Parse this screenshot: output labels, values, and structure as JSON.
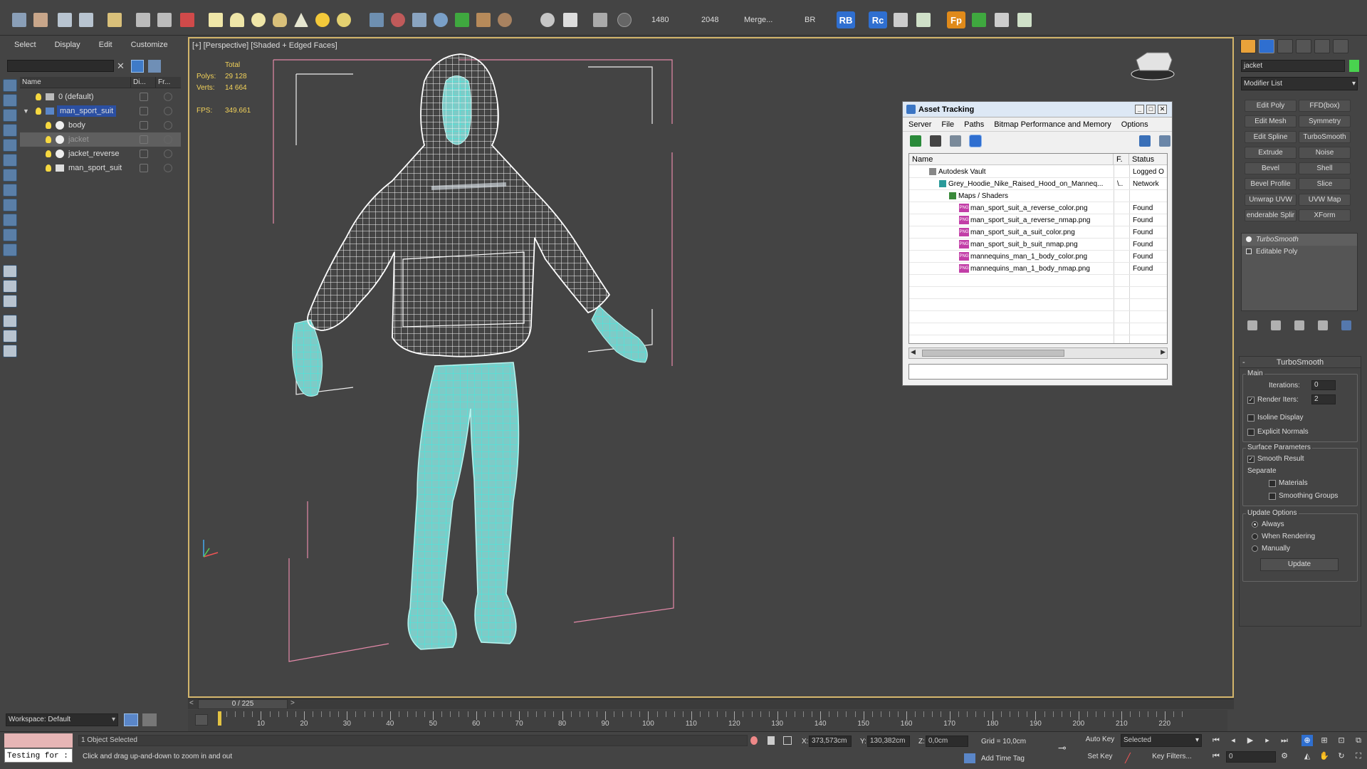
{
  "toolbar": {
    "values": [
      "1480",
      "2048"
    ],
    "merge_label": "Merge...",
    "br_label": "BR",
    "badges": [
      "RB",
      "Rc",
      "Fp"
    ]
  },
  "scene_explorer": {
    "menu": [
      "Select",
      "Display",
      "Edit",
      "Customize"
    ],
    "columns": {
      "name": "Name",
      "display": "Di...",
      "freeze": "Fr..."
    },
    "rows": [
      {
        "label": "0 (default)"
      },
      {
        "label": "man_sport_suit"
      },
      {
        "label": "body"
      },
      {
        "label": "jacket"
      },
      {
        "label": "jacket_reverse"
      },
      {
        "label": "man_sport_suit"
      }
    ],
    "workspace": "Workspace: Default"
  },
  "viewport": {
    "label": "[+] [Perspective] [Shaded + Edged Faces]",
    "stats": {
      "total_label": "Total",
      "polys_label": "Polys:",
      "polys_value": "29 128",
      "verts_label": "Verts:",
      "verts_value": "14 664",
      "fps_label": "FPS:",
      "fps_value": "349.661"
    }
  },
  "asset_tracking": {
    "title": "Asset Tracking",
    "menu": [
      "Server",
      "File",
      "Paths",
      "Bitmap Performance and Memory",
      "Options"
    ],
    "columns": {
      "name": "Name",
      "full_path": "F.",
      "status": "Status"
    },
    "rows": [
      {
        "name": "Autodesk Vault",
        "path": "",
        "status": "Logged O"
      },
      {
        "name": "Grey_Hoodie_Nike_Raised_Hood_on_Manneq...",
        "path": "\\..",
        "status": "Network"
      },
      {
        "name": "Maps / Shaders",
        "path": "",
        "status": ""
      },
      {
        "name": "man_sport_suit_a_reverse_color.png",
        "path": "",
        "status": "Found"
      },
      {
        "name": "man_sport_suit_a_reverse_nmap.png",
        "path": "",
        "status": "Found"
      },
      {
        "name": "man_sport_suit_a_suit_color.png",
        "path": "",
        "status": "Found"
      },
      {
        "name": "man_sport_suit_b_suit_nmap.png",
        "path": "",
        "status": "Found"
      },
      {
        "name": "mannequins_man_1_body_color.png",
        "path": "",
        "status": "Found"
      },
      {
        "name": "mannequins_man_1_body_nmap.png",
        "path": "",
        "status": "Found"
      }
    ],
    "file_badge": "PNG"
  },
  "command_panel": {
    "object_name": "jacket",
    "object_color": "#49d34f",
    "modifier_list": "Modifier List",
    "modifier_buttons": [
      "Edit Poly",
      "FFD(box)",
      "Edit Mesh",
      "Symmetry",
      "Edit Spline",
      "TurboSmooth",
      "Extrude",
      "Noise",
      "Bevel",
      "Shell",
      "Bevel Profile",
      "Slice",
      "Unwrap UVW",
      "UVW Map",
      "enderable Splir",
      "XForm"
    ],
    "stack": [
      "TurboSmooth",
      "Editable Poly"
    ],
    "turbosmooth": {
      "title": "TurboSmooth",
      "main_label": "Main",
      "iterations_label": "Iterations:",
      "iterations_value": "0",
      "render_iters_label": "Render Iters:",
      "render_iters_value": "2",
      "render_iters_checked": true,
      "isoline_label": "Isoline Display",
      "isoline_checked": false,
      "explicit_normals_label": "Explicit Normals",
      "explicit_normals_checked": false,
      "surface_label": "Surface Parameters",
      "smooth_result_label": "Smooth Result",
      "smooth_result_checked": true,
      "separate_label": "Separate",
      "materials_label": "Materials",
      "smoothing_groups_label": "Smoothing Groups",
      "update_options_label": "Update Options",
      "always_label": "Always",
      "when_rendering_label": "When Rendering",
      "manually_label": "Manually",
      "update_mode": "Always",
      "update_button": "Update"
    }
  },
  "timeline": {
    "frame_display": "0 / 225",
    "ticks": [
      0,
      10,
      20,
      30,
      40,
      50,
      60,
      70,
      80,
      90,
      100,
      110,
      120,
      130,
      140,
      150,
      160,
      170,
      180,
      190,
      200,
      210,
      220
    ],
    "labeled_ticks": [
      10,
      20,
      30,
      40,
      50,
      60,
      70,
      80,
      90,
      100,
      110,
      120,
      130,
      140,
      150,
      160,
      170,
      180,
      190,
      200,
      210,
      220
    ],
    "max_frame": 225
  },
  "status": {
    "maxscript_input": "Testing for :",
    "selection_text": "1 Object Selected",
    "prompt_text": "Click and drag up-and-down to zoom in and out",
    "x_label": "X:",
    "x_value": "373,573cm",
    "y_label": "Y:",
    "y_value": "130,382cm",
    "z_label": "Z:",
    "z_value": "0,0cm",
    "grid_text": "Grid = 10,0cm",
    "add_time_tag": "Add Time Tag",
    "auto_key": "Auto Key",
    "selected_dropdown": "Selected",
    "set_key": "Set Key",
    "key_filters": "Key Filters...",
    "current_frame": "0"
  }
}
